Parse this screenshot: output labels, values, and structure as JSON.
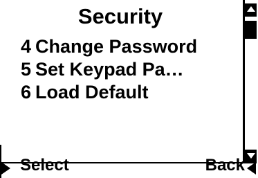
{
  "screen": {
    "title": "Security",
    "items": [
      {
        "number": "4",
        "label": "Change Password"
      },
      {
        "number": "5",
        "label": "Set Keypad Pa…"
      },
      {
        "number": "6",
        "label": "Load Default"
      }
    ]
  },
  "softkeys": {
    "left_label": "Select",
    "right_label": "Back"
  },
  "icons": {
    "scroll_up": "triangle-up-icon",
    "scroll_down": "triangle-down-icon",
    "select_arrow": "triangle-right-icon",
    "back_arrow": "triangle-left-icon"
  },
  "colors": {
    "foreground": "#000000",
    "background": "#ffffff"
  }
}
